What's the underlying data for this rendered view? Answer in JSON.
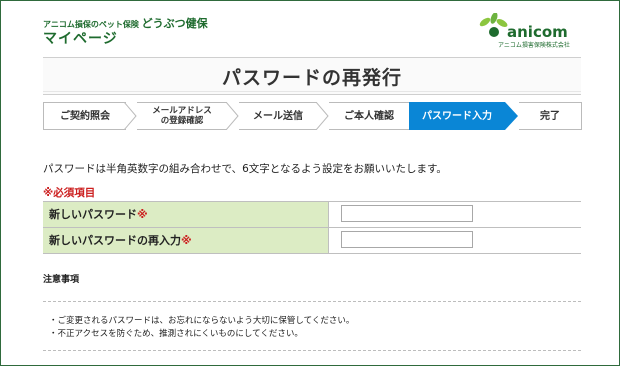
{
  "header": {
    "subtitle": "アニコム損保のペット保険",
    "brand": "どうぶつ健保",
    "title": "マイページ",
    "logo_word": "anicom",
    "logo_sub": "アニコム損害保険株式会社",
    "brand_color": "#1e6b2e"
  },
  "page_title": "パスワードの再発行",
  "steps": [
    {
      "label": "ご契約照会",
      "active": false
    },
    {
      "label": "メールアドレス\nの登録確認",
      "active": false
    },
    {
      "label": "メール送信",
      "active": false
    },
    {
      "label": "ご本人確認",
      "active": false
    },
    {
      "label": "パスワード入力",
      "active": true
    },
    {
      "label": "完了",
      "active": false
    }
  ],
  "active_step_color": "#0a86d6",
  "notice": "パスワードは半角英数字の組み合わせで、6文字となるよう設定をお願いいたします。",
  "required_note": "※必須項目",
  "form": {
    "new_password_label": "新しいパスワード",
    "confirm_password_label": "新しいパスワードの再入力",
    "required_mark": "※",
    "new_password_value": "",
    "confirm_password_value": ""
  },
  "notes": {
    "title": "注意事項",
    "items": [
      "・ご変更されるパスワードは、お忘れにならないよう大切に保管してください。",
      "・不正アクセスを防ぐため、推測されにくいものにしてください。"
    ]
  }
}
